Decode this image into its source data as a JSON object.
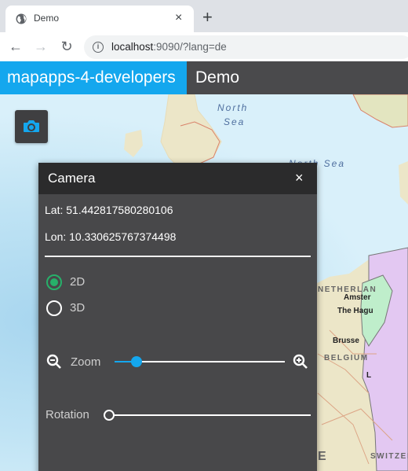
{
  "browser": {
    "tab_title": "Demo",
    "tab_close": "×",
    "new_tab": "+",
    "url_host": "localhost",
    "url_rest": ":9090/?lang=de",
    "back": "←",
    "forward": "→",
    "reload": "↻",
    "info": "i"
  },
  "app": {
    "brand": "mapapps-4-developers",
    "title": "Demo",
    "accent_color": "#14a7ee"
  },
  "map": {
    "labels": {
      "north_sea_1_line1": "North",
      "north_sea_1_line2": "Sea",
      "north_sea_2": "North Sea",
      "netherlands": "NETHERLAN",
      "amsterdam": "Amster",
      "the_hague": "The Hagu",
      "brussels": "Brusse",
      "belgium": "BELGIUM",
      "luxembourg": "L",
      "switzerland": "SWITZER",
      "france_fragment": "E"
    }
  },
  "tool_button": {
    "icon": "camera-icon"
  },
  "camera_panel": {
    "title": "Camera",
    "close": "×",
    "lat_label": "Lat: 51.442817580280106",
    "lon_label": "Lon: 10.330625767374498",
    "view_modes": [
      {
        "label": "2D",
        "checked": true
      },
      {
        "label": "3D",
        "checked": false
      }
    ],
    "zoom": {
      "label": "Zoom",
      "value_fraction": 0.13
    },
    "rotation": {
      "label": "Rotation",
      "value_fraction": 0.0
    },
    "radio_color": "#27b06a"
  }
}
